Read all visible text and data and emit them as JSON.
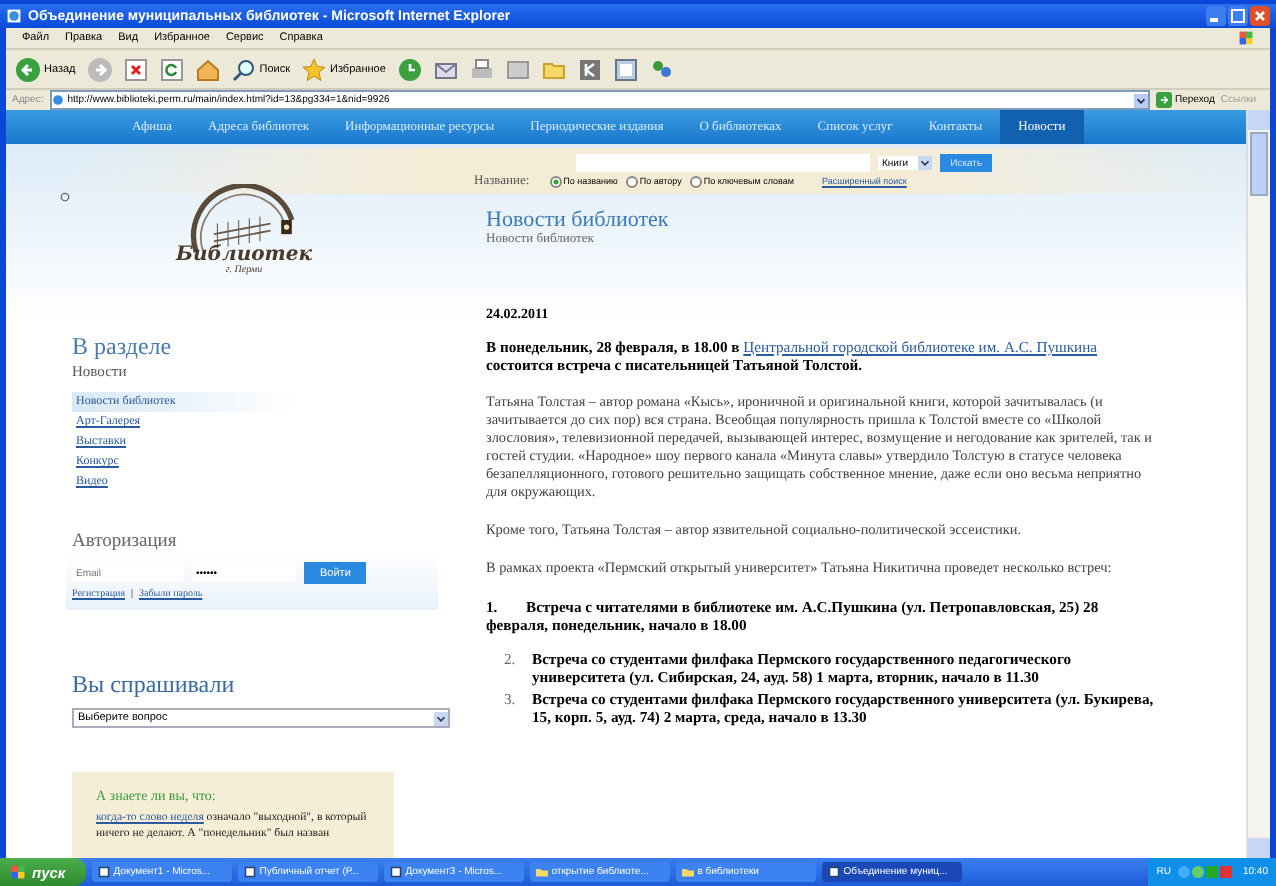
{
  "window": {
    "title": "Объединение муниципальных библиотек - Microsoft Internet Explorer"
  },
  "menu": [
    "Файл",
    "Правка",
    "Вид",
    "Избранное",
    "Сервис",
    "Справка"
  ],
  "toolbar": {
    "back": "Назад",
    "search": "Поиск",
    "favorites": "Избранное"
  },
  "address": {
    "label": "Адрес:",
    "url": "http://www.biblioteki.perm.ru/main/index.html?id=13&pg334=1&nid=9926",
    "go": "Переход",
    "links": "Ссылки"
  },
  "nav": [
    {
      "label": "Афиша",
      "selected": false
    },
    {
      "label": "Адреса библиотек",
      "selected": false
    },
    {
      "label": "Информационные ресурсы",
      "selected": false
    },
    {
      "label": "Периодические издания",
      "selected": false
    },
    {
      "label": "О библиотеках",
      "selected": false
    },
    {
      "label": "Список услуг",
      "selected": false
    },
    {
      "label": "Контакты",
      "selected": false
    },
    {
      "label": "Новости",
      "selected": true
    }
  ],
  "logo": {
    "name": "Библиотек",
    "city": "г. Перми"
  },
  "search": {
    "label": "Название:",
    "category": "Книги",
    "button": "Искать",
    "radios": [
      {
        "label": "По названию",
        "selected": true
      },
      {
        "label": "По автору",
        "selected": false
      },
      {
        "label": "По ключевым словам",
        "selected": false
      }
    ],
    "advanced": "Расширенный поиск"
  },
  "sidebar": {
    "title": "В разделе",
    "subtitle": "Новости",
    "links": [
      {
        "label": "Новости библиотек",
        "selected": true
      },
      {
        "label": "Арт-Галерея",
        "selected": false
      },
      {
        "label": "Выставки",
        "selected": false
      },
      {
        "label": "Конкурс",
        "selected": false
      },
      {
        "label": "Видео",
        "selected": false
      }
    ],
    "auth": {
      "title": "Авторизация",
      "email_placeholder": "Email",
      "password": "••••••",
      "button": "Войти",
      "register": "Регистрация",
      "separator": "|",
      "forgot": "Забыли пароль"
    },
    "faq": {
      "title": "Вы спрашивали",
      "select": "Выберите вопрос"
    },
    "did_you_know": {
      "title": "А знаете ли вы, что:",
      "link": "когда-то слово неделя",
      "text": "означало \"выходной\", в который ничего не делают. А \"понедельник\" был назван"
    }
  },
  "article": {
    "heading": "Новости библиотек",
    "subheading": "Новости библиотек",
    "date": "24.02.2011",
    "lead": {
      "before": "В понедельник, 28 февраля, в 18.00 в",
      "link": "Центральной городской библиотеке им. А.С. Пушкина",
      "after": "состоится встреча с писательницей Татьяной Толстой."
    },
    "paragraphs": [
      "Татьяна Толстая – автор романа «Кысь», ироничной и оригинальной книги, которой зачитывалась (и зачитывается до сих пор) вся страна. Всеобщая популярность пришла к Толстой вместе со «Школой злословия», телевизионной передачей, вызывающей интерес, возмущение и негодование как зрителей, так и гостей студии. «Народное» шоу первого канала «Минута славы» утвердило Толстую в статусе человека безапелляционного, готового решительно защищать собственное мнение, даже если оно весьма неприятно для окружающих.",
      "Кроме того, Татьяна Толстая – автор язвительной социально-политической эссеистики.",
      "В рамках проекта «Пермский открытый университет» Татьяна Никитична проведет несколько встреч:"
    ],
    "meetings": [
      {
        "kind": "flush",
        "number": "1.",
        "text": "Встреча с читателями в библиотеке им. А.С.Пушкина (ул. Петропавловская, 25) 28 февраля, понедельник, начало в 18.00"
      },
      {
        "kind": "indented",
        "number": "2.",
        "text": "Встреча со студентами филфака Пермского государственного педагогического университета (ул. Сибирская, 24, ауд. 58) 1 марта, вторник, начало в 11.30"
      },
      {
        "kind": "indented",
        "number": "3.",
        "text": "Встреча со студентами филфака Пермского государственного университета (ул. Букирева, 15, корп. 5, ауд. 74) 2 марта, среда, начало в 13.30"
      }
    ]
  },
  "taskbar": {
    "start": "пуск",
    "tasks": [
      {
        "label": "Документ1 - Micros...",
        "selected": false
      },
      {
        "label": "Публичный отчет (Р...",
        "selected": false
      },
      {
        "label": "Документ3 - Micros...",
        "selected": false
      },
      {
        "label": "открытие библиоте...",
        "selected": false
      },
      {
        "label": "в библиотеки",
        "selected": false
      },
      {
        "label": "Объединение муниц...",
        "selected": true
      }
    ],
    "lang": "RU",
    "time": "10:40"
  }
}
